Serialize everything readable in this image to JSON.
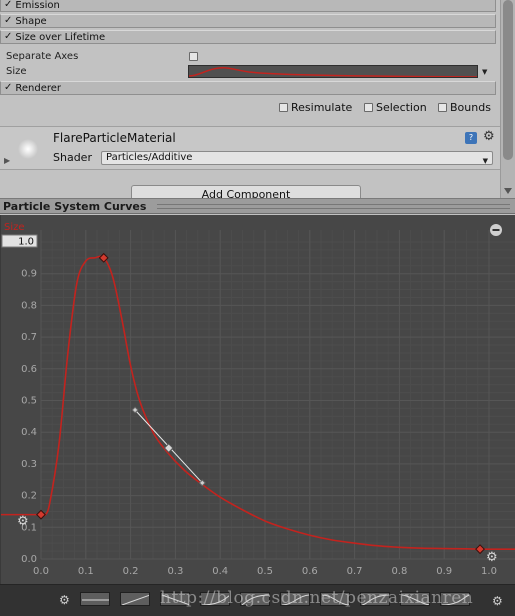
{
  "inspector": {
    "modules": [
      {
        "label": "Emission",
        "checked": true
      },
      {
        "label": "Shape",
        "checked": true
      },
      {
        "label": "Size over Lifetime",
        "checked": true
      },
      {
        "label": "Renderer",
        "checked": true
      }
    ],
    "size_over_lifetime": {
      "separate_axes_label": "Separate Axes",
      "separate_axes_checked": false,
      "size_label": "Size"
    },
    "toggles": {
      "resimulate": "Resimulate",
      "selection": "Selection",
      "bounds": "Bounds"
    },
    "material": {
      "name": "FlareParticleMaterial",
      "shader_label": "Shader",
      "shader_value": "Particles/Additive"
    },
    "add_component": "Add Component",
    "check_glyph": "✓"
  },
  "curves": {
    "title": "Particle System Curves",
    "axis_label": "Size",
    "max_value_field": "1.0",
    "colors": {
      "curve": "#c3231e",
      "grid": "#565656",
      "background": "#474747",
      "tick_text": "#a8a8a8"
    },
    "chart_data": {
      "type": "line",
      "title": "",
      "xlabel": "",
      "ylabel": "Size",
      "xlim": [
        0.0,
        1.0
      ],
      "ylim": [
        0.0,
        1.0
      ],
      "x_ticks": [
        "0.0",
        "0.1",
        "0.2",
        "0.3",
        "0.4",
        "0.5",
        "0.6",
        "0.7",
        "0.8",
        "0.9",
        "1.0"
      ],
      "y_ticks": [
        "0.0",
        "0.1",
        "0.2",
        "0.3",
        "0.4",
        "0.5",
        "0.6",
        "0.7",
        "0.8",
        "0.9"
      ],
      "grid": true,
      "series": [
        {
          "x": [
            0.0,
            0.01,
            0.02,
            0.04,
            0.06,
            0.08,
            0.1,
            0.12,
            0.14,
            0.16,
            0.18,
            0.2,
            0.22,
            0.25,
            0.28,
            0.32,
            0.36,
            0.4,
            0.45,
            0.5,
            0.55,
            0.6,
            0.65,
            0.7,
            0.75,
            0.8,
            0.85,
            0.9,
            0.95,
            0.98,
            1.0
          ],
          "y": [
            0.14,
            0.14,
            0.18,
            0.36,
            0.65,
            0.87,
            0.94,
            0.95,
            0.95,
            0.89,
            0.76,
            0.61,
            0.5,
            0.4,
            0.34,
            0.28,
            0.235,
            0.195,
            0.155,
            0.12,
            0.095,
            0.075,
            0.06,
            0.05,
            0.042,
            0.037,
            0.034,
            0.033,
            0.032,
            0.031,
            0.031
          ]
        }
      ],
      "keys": [
        {
          "x": 0.0,
          "y": 0.14
        },
        {
          "x": 0.14,
          "y": 0.95
        },
        {
          "x": 0.285,
          "y": 0.35
        },
        {
          "x": 0.98,
          "y": 0.031
        }
      ],
      "tangent": {
        "from": [
          0.21,
          0.47
        ],
        "to": [
          0.36,
          0.24
        ]
      }
    },
    "presets": [
      "flat",
      "linear-up",
      "linear-down",
      "ease-in",
      "ease-out",
      "ease-in-out",
      "ease-in-out-2",
      "ease-in-out-3",
      "s-curve",
      "s-curve-2"
    ]
  },
  "watermark": "http://blog.csdn.net/penzaixianren"
}
